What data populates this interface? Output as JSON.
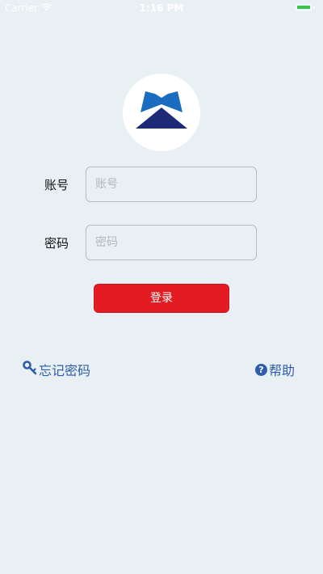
{
  "status_bar": {
    "carrier": "Carrier",
    "time": "1:16 PM"
  },
  "login_form": {
    "account_label": "账号",
    "account_placeholder": "账号",
    "password_label": "密码",
    "password_placeholder": "密码",
    "login_button": "登录"
  },
  "footer": {
    "forgot_password": "忘记密码",
    "help": "帮助"
  },
  "colors": {
    "background": "#e8f0f3",
    "login_button": "#e31b23",
    "link": "#2e5dab",
    "battery": "#33c748"
  }
}
